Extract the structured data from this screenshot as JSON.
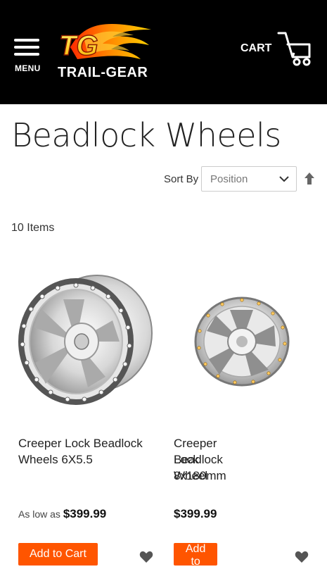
{
  "header": {
    "menu_label": "MENU",
    "logo_text": "TRAIL-GEAR",
    "logo_mark": "TG",
    "cart_label": "CART",
    "brand_orange": "#ff5500"
  },
  "page": {
    "title": "Beadlock Wheels",
    "items_count": "10 Items"
  },
  "sort": {
    "label": "Sort By",
    "selected": "Position"
  },
  "products": [
    {
      "name_line1": "Creeper Lock Beadlock",
      "name_line2": "Wheels 6X5.5",
      "price_prefix": "As low as",
      "price": "$399.99",
      "add_label": "Add to Cart"
    },
    {
      "name_line1": "Creeper Lock 8x180mm",
      "name_line2": "Beadlock Wheel",
      "price_prefix": "",
      "price": "$399.99",
      "add_label": "Add to Cart"
    }
  ]
}
